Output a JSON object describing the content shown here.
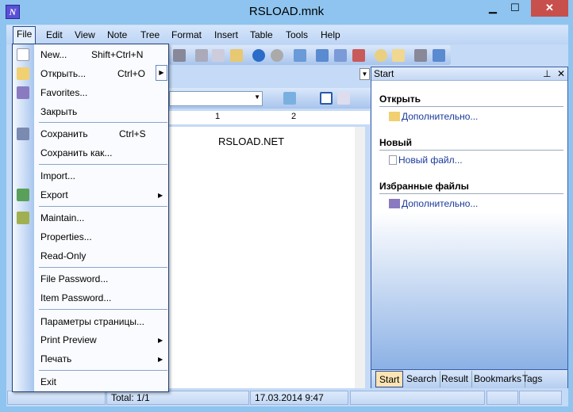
{
  "window": {
    "title": "RSLOAD.mnk",
    "min": "▁",
    "max": "☐",
    "close": "✕",
    "app_icon": "N"
  },
  "menubar": [
    "File",
    "Edit",
    "View",
    "Note",
    "Tree",
    "Format",
    "Insert",
    "Table",
    "Tools",
    "Help"
  ],
  "file_menu": {
    "items": [
      {
        "label": "New...",
        "shortcut": "Shift+Ctrl+N"
      },
      {
        "label": "Открыть...",
        "shortcut": "Ctrl+O",
        "submenu": true
      },
      {
        "label": "Favorites..."
      },
      {
        "label": "Закрыть"
      },
      {
        "label": "Сохранить",
        "shortcut": "Ctrl+S"
      },
      {
        "label": "Сохранить как..."
      },
      {
        "label": "Import..."
      },
      {
        "label": "Export",
        "submenu": true
      },
      {
        "label": "Maintain..."
      },
      {
        "label": "Properties..."
      },
      {
        "label": "Read-Only"
      },
      {
        "label": "File Password..."
      },
      {
        "label": "Item Password..."
      },
      {
        "label": "Параметры страницы..."
      },
      {
        "label": "Print Preview",
        "submenu": true
      },
      {
        "label": "Печать",
        "submenu": true
      },
      {
        "label": "Exit"
      }
    ]
  },
  "ruler": {
    "marks": [
      "1",
      "2"
    ]
  },
  "editor": {
    "text": "RSLOAD.NET"
  },
  "panel": {
    "title": "Start",
    "pin": "⊥",
    "close": "✕",
    "sections": [
      {
        "heading": "Открыть",
        "link": "Дополнительно..."
      },
      {
        "heading": "Новый",
        "link": "Новый файл..."
      },
      {
        "heading": "Избранные файлы",
        "link": "Дополнительно..."
      }
    ],
    "tabs": [
      "Start",
      "Search",
      "Result",
      "Bookmarks",
      "Tags"
    ]
  },
  "status": {
    "total": "Total: 1/1",
    "date": "17.03.2014 9:47"
  },
  "colors": {
    "accent": "#1f3f7f",
    "title_bar": "#8ec4ef",
    "close": "#c7504c",
    "link": "#1a3a9c"
  }
}
